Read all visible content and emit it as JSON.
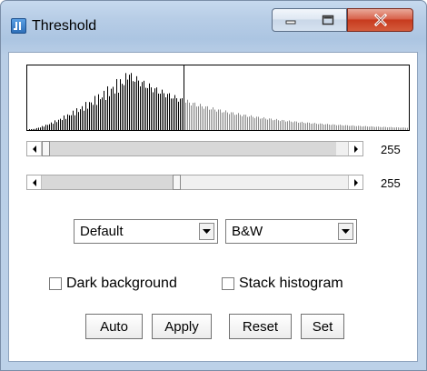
{
  "window": {
    "title": "Threshold",
    "app_icon": "imagej-icon",
    "controls": [
      "minimize-icon",
      "maximize-icon",
      "close-icon"
    ]
  },
  "histogram": {
    "type": "histogram",
    "selected_range": [
      0,
      255
    ],
    "highlight_color": "#000000"
  },
  "sliders": {
    "lower": {
      "value": "255",
      "level": 0.0
    },
    "upper": {
      "value": "255",
      "level": 0.45
    }
  },
  "method_select": {
    "selected": "Default"
  },
  "display_select": {
    "selected": "B&W"
  },
  "checkboxes": {
    "dark_background": {
      "label": "Dark background",
      "checked": false
    },
    "stack_histogram": {
      "label": "Stack histogram",
      "checked": false
    }
  },
  "buttons": {
    "auto": "Auto",
    "apply": "Apply",
    "reset": "Reset",
    "set": "Set"
  },
  "colors": {
    "titlebar": "#b7cde6",
    "close_button": "#c73b1f",
    "background": "#ffffff"
  }
}
